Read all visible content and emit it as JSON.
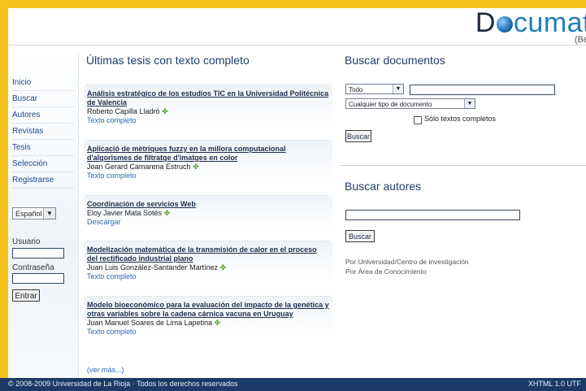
{
  "logo": {
    "prefix": "D",
    "rest": "cumat",
    "sub": "(Bet"
  },
  "sidebar": {
    "nav": [
      {
        "label": "Inicio"
      },
      {
        "label": "Buscar"
      },
      {
        "label": "Autores"
      },
      {
        "label": "Revistas"
      },
      {
        "label": "Tesis"
      },
      {
        "label": "Selección"
      },
      {
        "label": "Registrarse"
      }
    ],
    "language": "Español",
    "user_label": "Usuario",
    "password_label": "Contraseña",
    "enter_label": "Entrar"
  },
  "main": {
    "title": "Últimas tesis con texto completo",
    "theses": [
      {
        "title": "Análisis estratégico de los estudios TIC en la Universidad Politécnica de Valencia",
        "author": "Roberto Capilla Lladró",
        "link": "Texto completo"
      },
      {
        "title": "Aplicació de mètriques fuzzy en la millora computacional d'algorismes de filtratge d'imatges en color",
        "author": "Joan Gerard Camarena Estruch",
        "link": "Texto completo"
      },
      {
        "title": "Coordinación de servicios Web",
        "author": "Eloy Javier Mata Sotés",
        "link": "Descargar"
      },
      {
        "title": "Modelización matemática de la transmisión de calor en el proceso del rectificado industrial plano",
        "author": "Juan Luis González-Santander Martínez",
        "link": "Texto completo"
      },
      {
        "title": "Modelo bioeconómico para la evaluación del impacto de la genética y otras variables sobre la cadena cárnica vacuna en Uruguay",
        "author": "Juan Manuel Soares de Lima Lapetina",
        "link": "Texto completo"
      }
    ],
    "more": "(ver más...)"
  },
  "search_docs": {
    "title": "Buscar documentos",
    "scope": "Todo",
    "doc_type": "Cualquier tipo de documento",
    "fulltext_label": "Sólo textos completos",
    "button": "Buscar"
  },
  "search_authors": {
    "title": "Buscar autores",
    "button": "Buscar",
    "links": [
      "Por Universidad/Centro de investigación",
      "Por Área de Conocimiento"
    ]
  },
  "footer": {
    "left": "© 2008-2009 Universidad de La Rioja · Todos los derechos reservados",
    "right": "XHTML 1.0 UTF"
  },
  "colors": {
    "frame": "#f7c21c",
    "footer": "#1b3a66",
    "heading": "#1f3f6a",
    "link": "#2a6ab5"
  }
}
